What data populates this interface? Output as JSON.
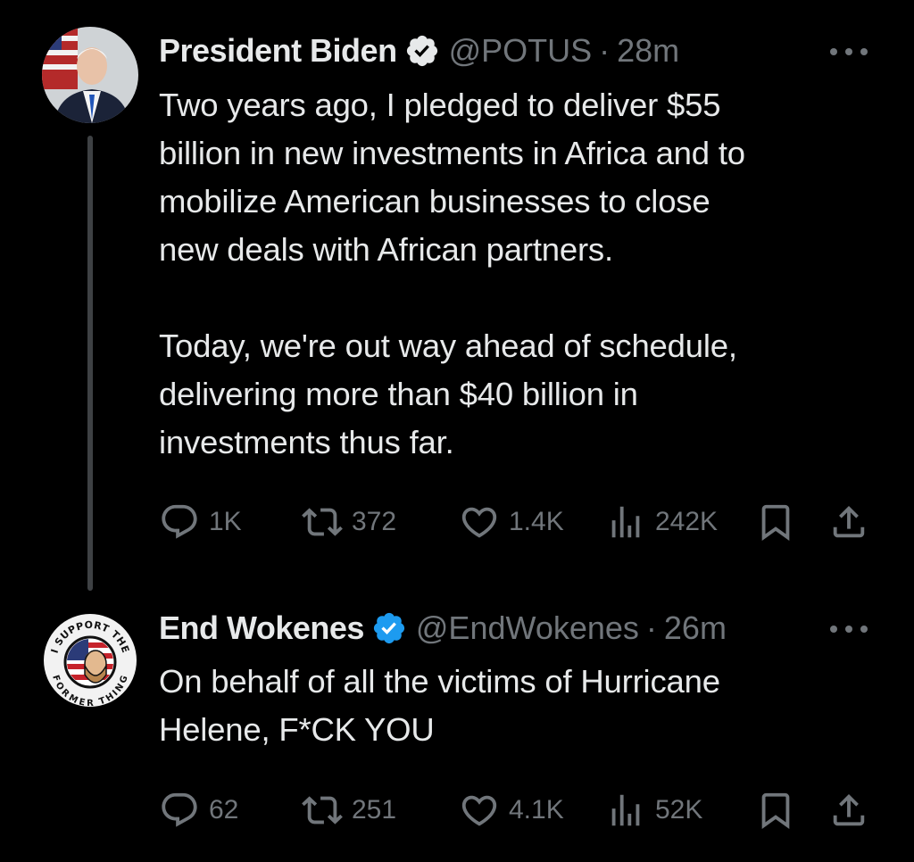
{
  "tweets": [
    {
      "author": {
        "name": "President Biden",
        "handle": "@POTUS",
        "verified": true,
        "verified_color": "#e7e9ea",
        "avatar": "portrait-with-flag"
      },
      "separator": "·",
      "time": "28m",
      "text": "Two years ago, I pledged to deliver $55\nbillion in new investments in Africa and to\nmobilize American businesses to close\nnew deals with African partners.\n\nToday, we're out way ahead of schedule,\ndelivering more than $40 billion in\ninvestments thus far.",
      "stats": {
        "replies": "1K",
        "reposts": "372",
        "likes": "1.4K",
        "views": "242K"
      }
    },
    {
      "author": {
        "name": "End Wokenes",
        "handle": "@EndWokenes",
        "verified": true,
        "verified_color": "#1d9bf0",
        "avatar": "i-support-the-former-thing-badge",
        "avatar_text_top": "I SUPPORT THE",
        "avatar_text_bottom": "FORMER THING"
      },
      "separator": "·",
      "time": "26m",
      "text": "On behalf of all the victims of Hurricane\nHelene, F*CK YOU",
      "stats": {
        "replies": "62",
        "reposts": "251",
        "likes": "4.1K",
        "views": "52K"
      }
    }
  ],
  "icons": {
    "reply": "speech-bubble-icon",
    "repost": "repost-arrows-icon",
    "like": "heart-icon",
    "views": "bar-chart-icon",
    "bookmark": "bookmark-icon",
    "share": "share-upload-icon",
    "more": "ellipsis-icon"
  },
  "colors": {
    "background": "#000000",
    "text": "#e7e9ea",
    "muted": "#71767b",
    "verified_blue": "#1d9bf0"
  }
}
